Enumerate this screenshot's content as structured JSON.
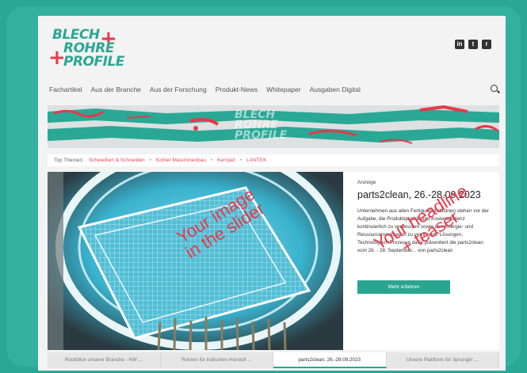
{
  "logo": {
    "line1": "BLECH",
    "line2": "ROHRE",
    "line3": "PROFILE",
    "plus": "+"
  },
  "social": [
    {
      "icon": "linkedin-icon",
      "glyph": "in"
    },
    {
      "icon": "twitter-icon",
      "glyph": "t"
    },
    {
      "icon": "rss-icon",
      "glyph": "r"
    }
  ],
  "nav": [
    "Fachartikel",
    "Aus der Branche",
    "Aus der Forschung",
    "Produkt-News",
    "Whitepaper",
    "Ausgaben Digital"
  ],
  "banner": {
    "line1": "BLECH",
    "line2": "ROHRE",
    "line3": "PROFILE"
  },
  "top_themes": {
    "label": "Top Themen:",
    "tags": [
      "Schweißen & Schneiden",
      "Kohler Maschinenbau",
      "Kemper",
      "LANTEK"
    ],
    "sep": "•"
  },
  "article": {
    "category": "Anzeige",
    "title": "parts2clean, 26.-28.09.2023",
    "body": "Unternehmen aus allen Fertigungsindustrien stehen vor der Aufgabe, die Produktqualität und Kosteneffizienz kontinuierlich zu verbessern sowie den Energie- und Ressourcenverbrauch zu verringern. Lösungen, Technologien, Prozesse dafür präsentiert die parts2clean vom 26. - 28. September... von parts2clean",
    "cta": "Mehr erfahren"
  },
  "tabs": [
    {
      "label": "Rückblick unserer Branche - KW ...",
      "active": false
    },
    {
      "label": "Rohren für indischen Horstoll ...",
      "active": false
    },
    {
      "label": "parts2clean, 26.-28.09.2023",
      "active": true
    },
    {
      "label": "Unsere Plattform für Sprungbr ...",
      "active": false
    }
  ],
  "overlays": {
    "image": [
      "Your image",
      "in the slider"
    ],
    "headline": [
      "Your headline",
      "+ teaser"
    ]
  },
  "colors": {
    "brand": "#2ba795",
    "accent": "#e8384a",
    "frame": "#2aa896"
  }
}
